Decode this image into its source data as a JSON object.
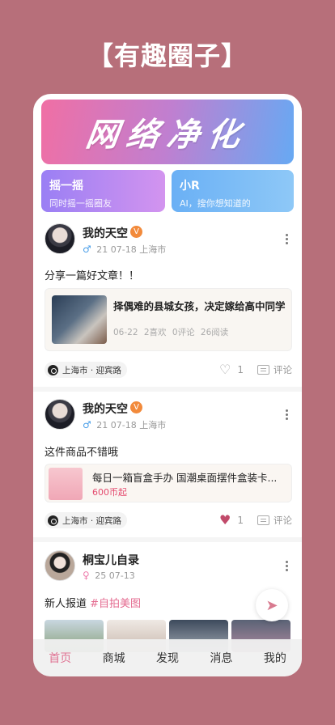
{
  "page_title": "【有趣圈子】",
  "banner": {
    "text": "网络净化"
  },
  "quick_actions": [
    {
      "title": "摇一摇",
      "subtitle": "同时摇一摇圈友"
    },
    {
      "title": "小R",
      "subtitle": "AI，搜你想知道的"
    }
  ],
  "posts": [
    {
      "username": "我的天空",
      "badge": "V",
      "gender": "♂",
      "age": "21",
      "date": "07-18",
      "city": "上海市",
      "text": "分享一篇好文章！！",
      "article": {
        "title": "择偶难的县城女孩，决定嫁给高中同学",
        "date": "06-22",
        "likes": "2喜欢",
        "comments": "0评论",
        "reads": "26阅读"
      },
      "location": "上海市 · 迎宾路",
      "like_count": "1",
      "liked": false,
      "comment_label": "评论"
    },
    {
      "username": "我的天空",
      "badge": "V",
      "gender": "♂",
      "age": "21",
      "date": "07-18",
      "city": "上海市",
      "text": "这件商品不错哦",
      "product": {
        "title": "每日一箱盲盒手办 国潮桌面摆件盒装卡...",
        "price": "600币起"
      },
      "location": "上海市 · 迎宾路",
      "like_count": "1",
      "liked": true,
      "comment_label": "评论"
    },
    {
      "username": "桐宝儿自录",
      "gender": "♀",
      "age": "25",
      "date": "07-13",
      "text": "新人报道",
      "tag": "#自拍美图"
    }
  ],
  "tabs": [
    {
      "label": "首页",
      "active": true
    },
    {
      "label": "商城",
      "active": false
    },
    {
      "label": "发现",
      "active": false
    },
    {
      "label": "消息",
      "active": false
    },
    {
      "label": "我的",
      "active": false
    }
  ]
}
